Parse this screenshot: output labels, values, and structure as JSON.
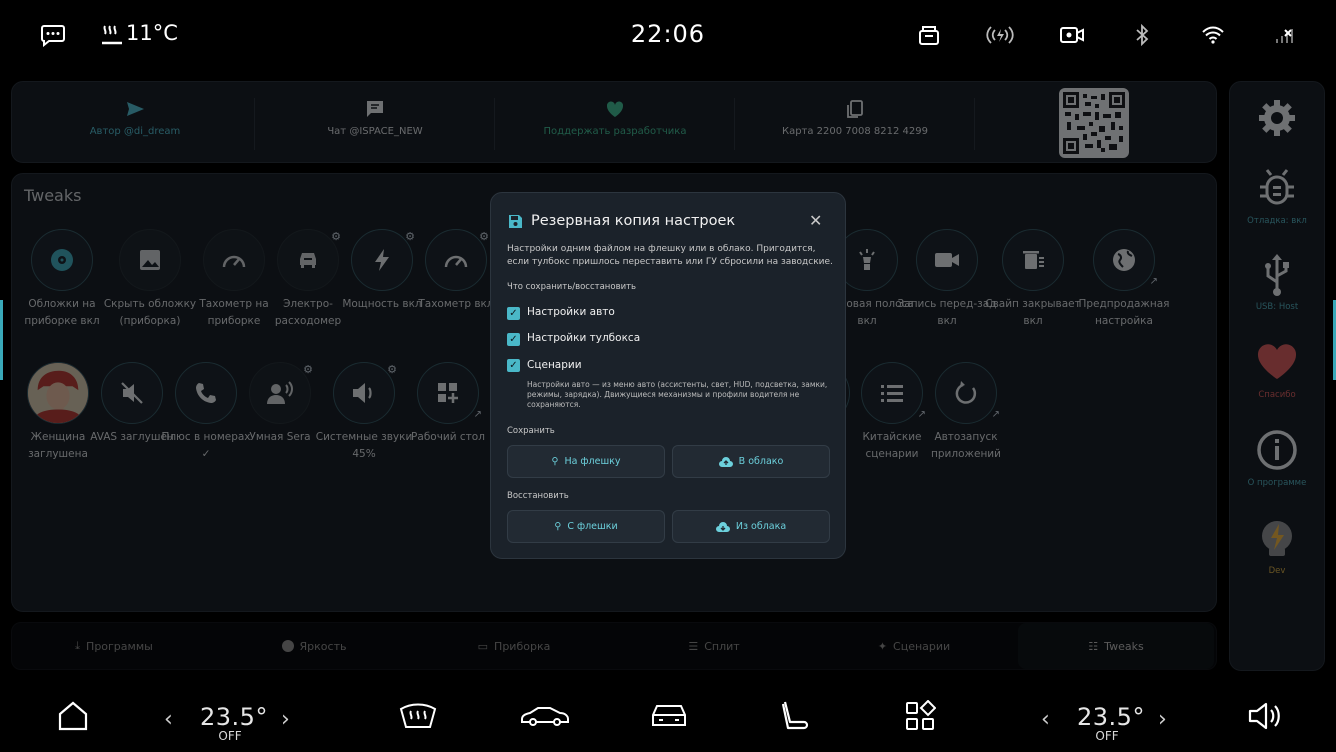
{
  "status_bar": {
    "outside_temp": "11°C",
    "time": "22:06"
  },
  "links": [
    {
      "label": "Автор @di_dream",
      "icon": "send-icon"
    },
    {
      "label": "Чат @ISPACE_NEW",
      "icon": "chat-icon"
    },
    {
      "label": "Поддержать разработчика",
      "icon": "heart-icon"
    },
    {
      "label": "Карта 2200 7008 8212 4299",
      "icon": "copy-icon"
    }
  ],
  "tweaks": {
    "title": "Tweaks",
    "row1": [
      {
        "label": "Обложки на приборке вкл",
        "icon": "disc-icon",
        "on": true
      },
      {
        "label": "Скрыть обложку (приборка)",
        "icon": "image-icon",
        "on": false
      },
      {
        "label": "Тахометр на приборке",
        "icon": "gauge-icon",
        "on": false
      },
      {
        "label": "Электро-расходомер",
        "icon": "ev-icon",
        "on": false
      },
      {
        "label": "Мощность вкл",
        "icon": "bolt-icon",
        "on": true
      },
      {
        "label": "Тахометр вкл",
        "icon": "gauge-icon",
        "on": true
      },
      {
        "label": "Световая полоса вкл",
        "icon": "lamp-icon",
        "on": true
      },
      {
        "label": "Запись перед-зад вкл",
        "icon": "camera-icon",
        "on": true
      },
      {
        "label": "Свайп закрывает вкл",
        "icon": "swipe-icon",
        "on": true
      },
      {
        "label": "Предпродажная настройка",
        "icon": "globe-icon",
        "on": true
      }
    ],
    "row2": [
      {
        "label": "Женщина заглушена",
        "icon": "avatar-icon",
        "on": true
      },
      {
        "label": "AVAS заглушён",
        "icon": "mute-icon",
        "on": true
      },
      {
        "label": "Плюс в номерах ✓",
        "icon": "phone-icon",
        "on": true
      },
      {
        "label": "Умная Sera",
        "icon": "voice-icon",
        "on": false
      },
      {
        "label": "Системные звуки",
        "sub": "45%",
        "icon": "volume-icon",
        "on": true
      },
      {
        "label": "Рабочий стол",
        "icon": "add-widget-icon",
        "on": true
      },
      {
        "label": "Китайские сценарии",
        "icon": "list-icon",
        "on": true
      },
      {
        "label": "Автозапуск приложений",
        "icon": "restart-icon",
        "on": true
      }
    ]
  },
  "tabs": [
    {
      "label": "Программы",
      "icon": "download-icon"
    },
    {
      "label": "Яркость",
      "icon": "brightness-icon"
    },
    {
      "label": "Приборка",
      "icon": "dashboard-icon"
    },
    {
      "label": "Сплит",
      "icon": "split-icon"
    },
    {
      "label": "Сценарии",
      "icon": "sparkle-icon"
    },
    {
      "label": "Tweaks",
      "icon": "tune-icon",
      "active": true
    }
  ],
  "rail": [
    {
      "label": "",
      "icon": "settings-icon"
    },
    {
      "label": "Отладка: вкл",
      "icon": "bug-icon"
    },
    {
      "label": "USB: Host",
      "icon": "usb-icon"
    },
    {
      "label": "Спасибо",
      "icon": "heart-icon"
    },
    {
      "label": "О программе",
      "icon": "info-icon"
    },
    {
      "label": "Dev",
      "icon": "dev-icon"
    }
  ],
  "dock": {
    "left_temp": "23.5°",
    "left_state": "OFF",
    "right_temp": "23.5°",
    "right_state": "OFF"
  },
  "modal": {
    "title": "Резервная копия настроек",
    "description": "Настройки одним файлом на флешку или в облако. Пригодится, если тулбокс пришлось переставить или ГУ сбросили на заводские.",
    "what_label": "Что сохранить/восстановить",
    "options": [
      {
        "label": "Настройки авто",
        "checked": true
      },
      {
        "label": "Настройки тулбокса",
        "checked": true
      },
      {
        "label": "Сценарии",
        "checked": true
      }
    ],
    "note": "Настройки авто — из меню авто (ассистенты, свет, HUD, подсветка, замки, режимы, зарядка). Движущиеся механизмы и профили водителя не сохраняются.",
    "save_label": "Сохранить",
    "save_usb": "На флешку",
    "save_cloud": "В облако",
    "restore_label": "Восстановить",
    "restore_usb": "С флешки",
    "restore_cloud": "Из облака"
  },
  "colors": {
    "accent": "#4ab8c8",
    "heart": "#d9534f",
    "background": "#000000"
  }
}
